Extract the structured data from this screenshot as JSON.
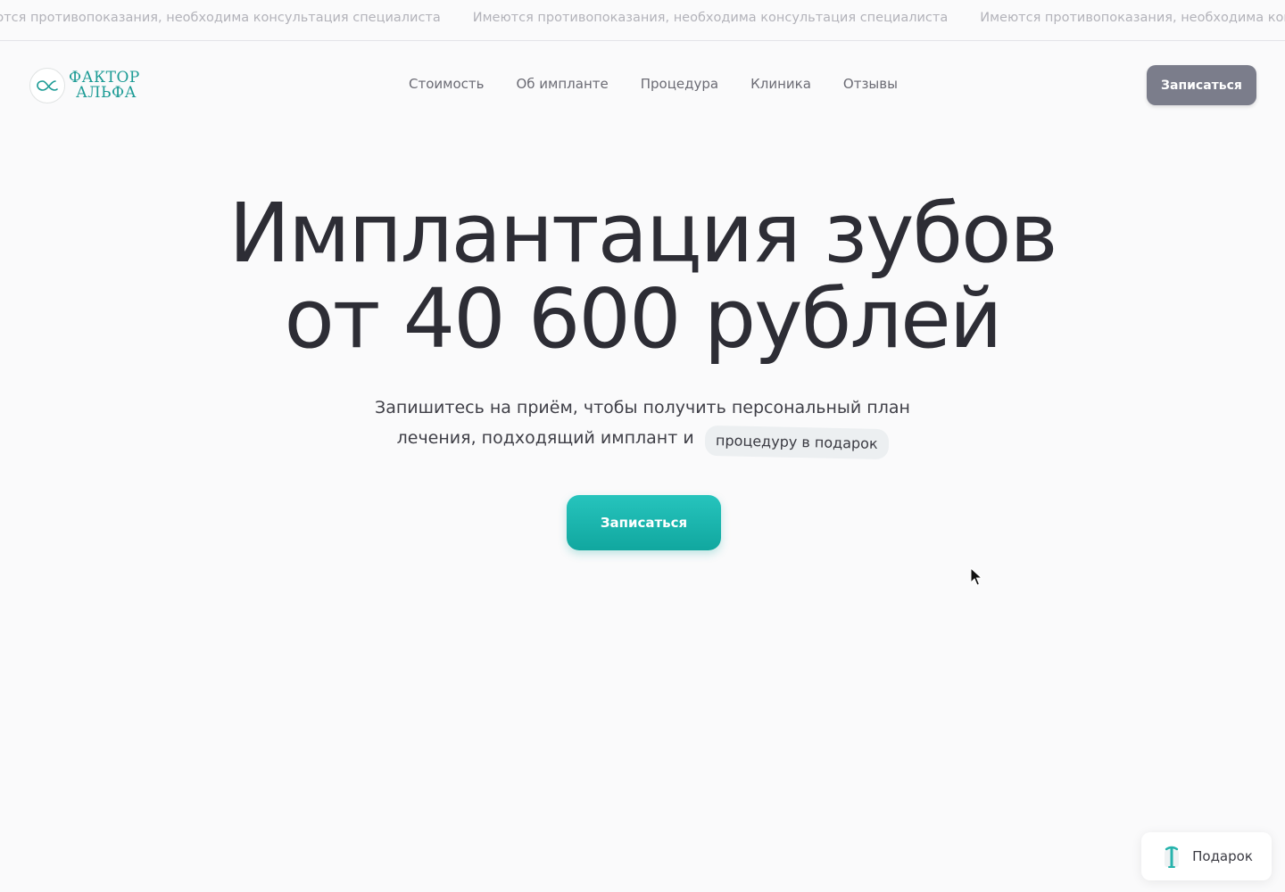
{
  "marquee": {
    "items": [
      "ются противопоказания, необходима консультация специалиста",
      "Имеются противопоказания, необходима консультация специалиста",
      "Имеются противопоказания, необходима консульт"
    ]
  },
  "header": {
    "logo": {
      "line1": "ФАКТОР",
      "line2": "АЛЬФА",
      "icon": "alpha-logo-icon"
    },
    "nav": [
      {
        "label": "Стоимость"
      },
      {
        "label": "Об импланте"
      },
      {
        "label": "Процедура"
      },
      {
        "label": "Клиника"
      },
      {
        "label": "Отзывы"
      }
    ],
    "cta_label": "Записаться"
  },
  "hero": {
    "title_line1": "Имплантация зубов",
    "title_line2": "от 40 600 рублей",
    "subtitle_line1": "Запишитесь на приём, чтобы получить персональный план",
    "subtitle_line2": "лечения, подходящий имплант и",
    "pill": "процедуру в подарок",
    "cta_label": "Записаться"
  },
  "gift": {
    "label": "Подарок",
    "icon": "gift-icon"
  },
  "colors": {
    "brand_teal": "#1c9b95",
    "cta_gradient_top": "#26c4bd",
    "cta_gradient_bottom": "#11a79f",
    "header_cta_bg": "#7b7d8b",
    "text_dark": "#2d2d35"
  }
}
